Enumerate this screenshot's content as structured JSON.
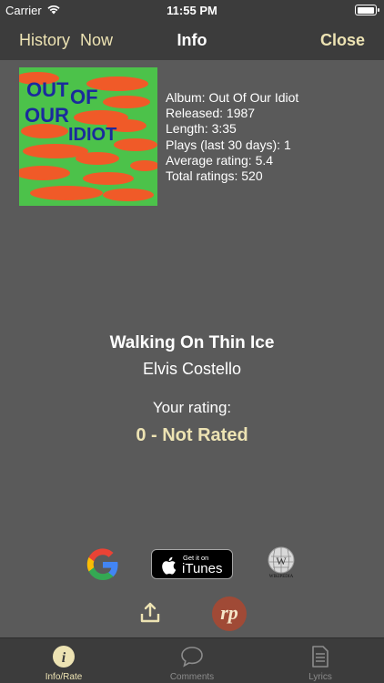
{
  "status_bar": {
    "carrier": "Carrier",
    "time": "11:55 PM"
  },
  "nav": {
    "history": "History",
    "now": "Now",
    "title": "Info",
    "close": "Close"
  },
  "album": {
    "cover_lines": [
      "OUT",
      "OF",
      "OUR",
      "IDIOT"
    ],
    "details": [
      "Album: Out Of Our Idiot",
      "Released: 1987",
      "Length: 3:35",
      "Plays (last 30 days): 1",
      "Average rating: 5.4",
      "Total ratings: 520"
    ]
  },
  "song": {
    "title": "Walking On Thin Ice",
    "artist": "Elvis Costello"
  },
  "rating": {
    "label": "Your rating:",
    "value": "0 - Not Rated"
  },
  "links": {
    "google_letter": "G",
    "itunes_small": "Get it on",
    "itunes_big": "iTunes",
    "wikipedia_name": "WIKIPEDIA",
    "rp_label": "rp"
  },
  "tabs": [
    {
      "label": "Info/Rate",
      "icon": "info-icon",
      "active": true
    },
    {
      "label": "Comments",
      "icon": "comment-icon",
      "active": false
    },
    {
      "label": "Lyrics",
      "icon": "document-icon",
      "active": false
    }
  ],
  "colors": {
    "background": "#5a5a5a",
    "bar": "#3c3c3c",
    "accent": "#ede3b3"
  }
}
